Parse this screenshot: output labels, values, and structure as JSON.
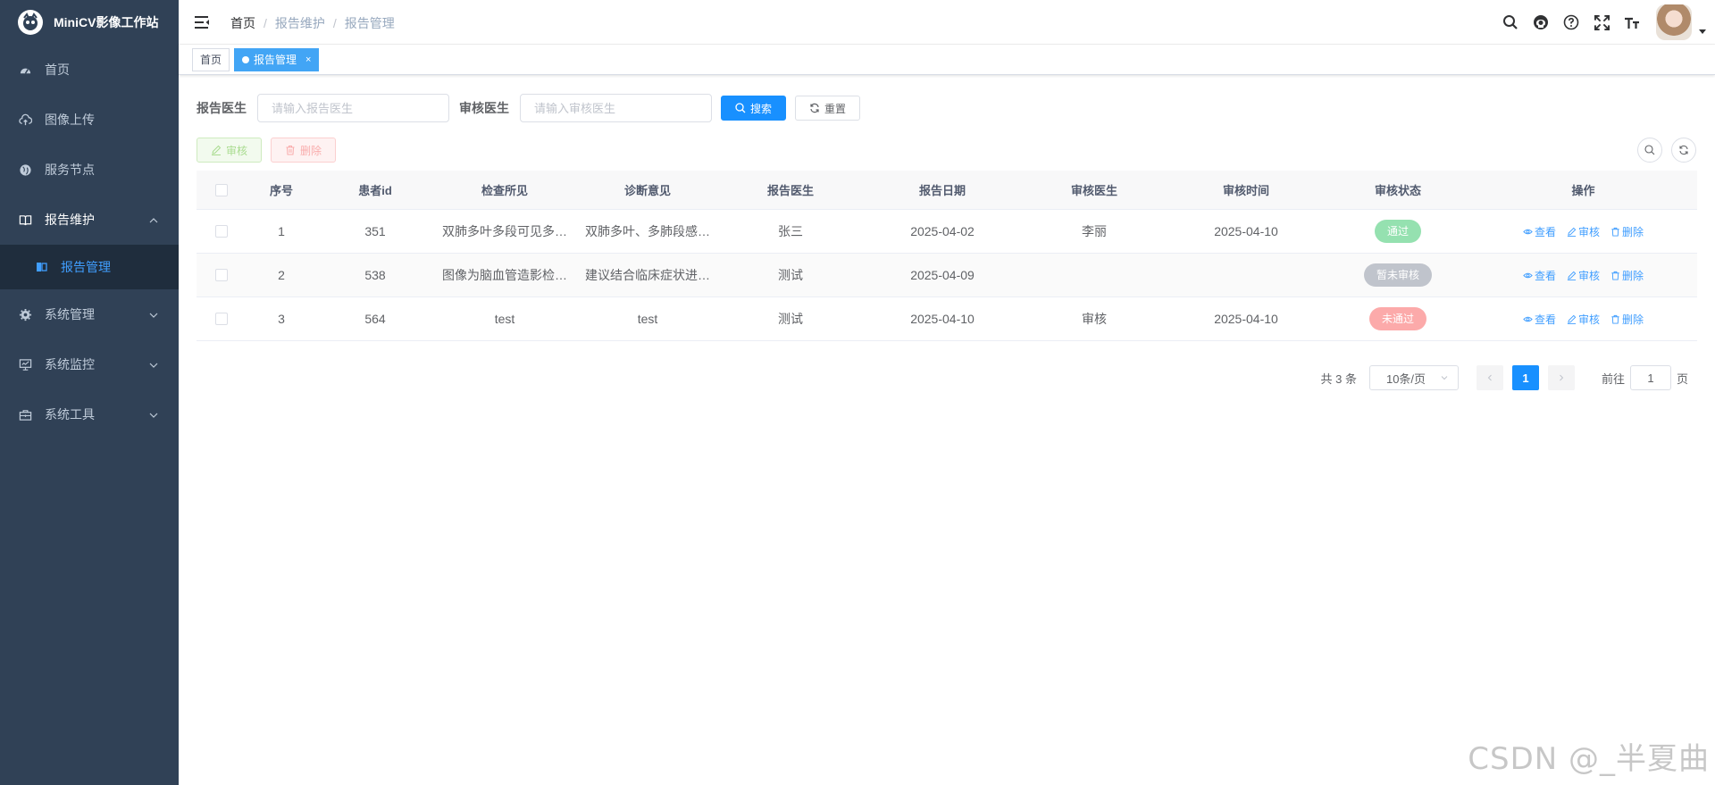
{
  "app": {
    "title": "MiniCV影像工作站"
  },
  "sidebar": {
    "items": [
      {
        "label": "首页",
        "icon": "dashboard-icon"
      },
      {
        "label": "图像上传",
        "icon": "cloud-upload-icon"
      },
      {
        "label": "服务节点",
        "icon": "globe-icon"
      },
      {
        "label": "报告维护",
        "icon": "book-icon"
      },
      {
        "label": "系统管理",
        "icon": "gear-icon"
      },
      {
        "label": "系统监控",
        "icon": "monitor-icon"
      },
      {
        "label": "系统工具",
        "icon": "toolbox-icon"
      }
    ],
    "sub_items": [
      {
        "label": "报告管理",
        "icon": "report-icon"
      }
    ]
  },
  "breadcrumb": {
    "home": "首页",
    "parent": "报告维护",
    "current": "报告管理"
  },
  "tags": {
    "home": "首页",
    "active": "报告管理",
    "close": "×"
  },
  "search": {
    "doctor_label": "报告医生",
    "doctor_placeholder": "请输入报告医生",
    "reviewer_label": "审核医生",
    "reviewer_placeholder": "请输入审核医生",
    "search_btn": "搜索",
    "reset_btn": "重置"
  },
  "toolbar": {
    "review_btn": "审核",
    "delete_btn": "删除"
  },
  "table": {
    "headers": [
      "序号",
      "患者id",
      "检查所见",
      "诊断意见",
      "报告医生",
      "报告日期",
      "审核医生",
      "审核时间",
      "审核状态",
      "操作"
    ],
    "rows": [
      {
        "index": "1",
        "patient_id": "351",
        "findings": "双肺多叶多段可见多发斑片影",
        "diagnosis": "双肺多叶、多肺段感染性病变",
        "doctor": "张三",
        "date": "2025-04-02",
        "reviewer": "李丽",
        "review_time": "2025-04-10",
        "status": "通过",
        "status_color": "#95e1b0"
      },
      {
        "index": "2",
        "patient_id": "538",
        "findings": "图像为脑血管造影检查所见",
        "diagnosis": "建议结合临床症状进一步检查",
        "doctor": "测试",
        "date": "2025-04-09",
        "reviewer": "",
        "review_time": "",
        "status": "暂未审核",
        "status_color": "#c0c4cc"
      },
      {
        "index": "3",
        "patient_id": "564",
        "findings": "test",
        "diagnosis": "test",
        "doctor": "测试",
        "date": "2025-04-10",
        "reviewer": "审核",
        "review_time": "2025-04-10",
        "status": "未通过",
        "status_color": "#fcaaaa"
      }
    ],
    "ops": {
      "view": "查看",
      "review": "审核",
      "delete": "删除"
    }
  },
  "pagination": {
    "total": "共 3 条",
    "page_size": "10条/页",
    "current_page": "1",
    "goto_label": "前往",
    "goto_value": "1",
    "page_unit": "页"
  },
  "watermark": "CSDN @_半夏曲"
}
